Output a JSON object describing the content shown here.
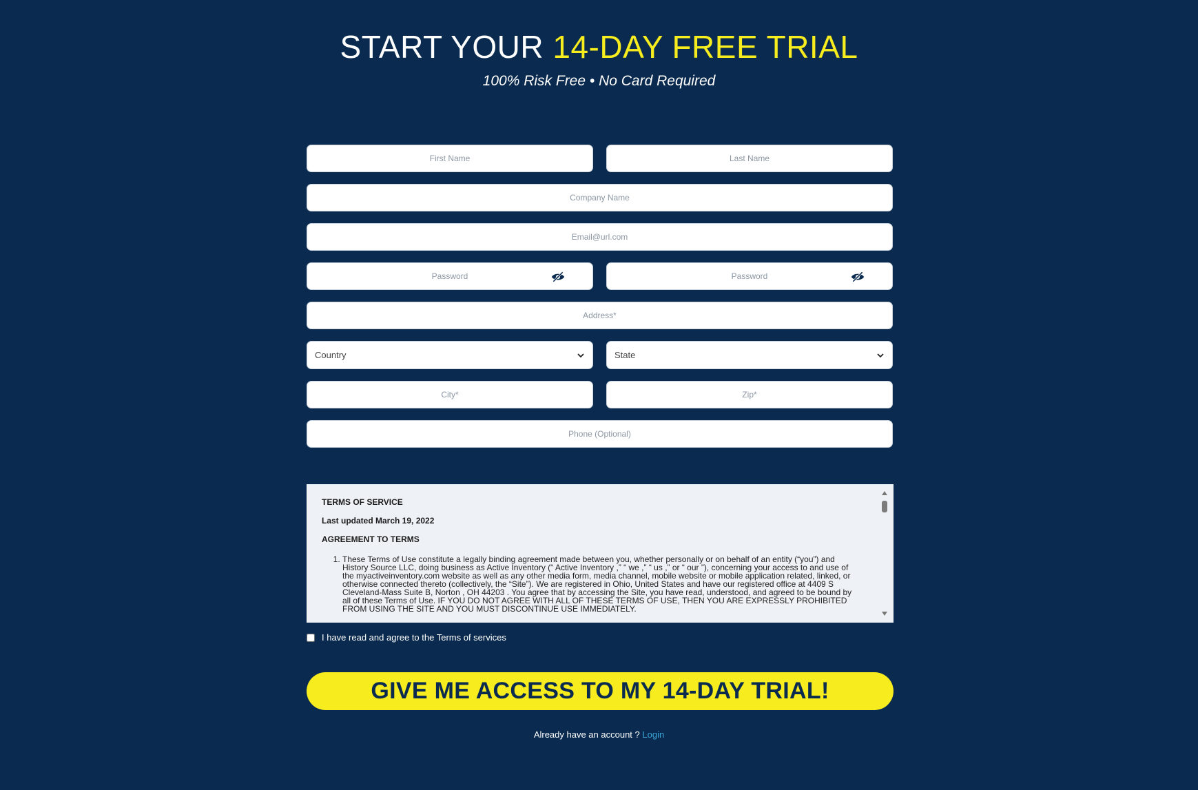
{
  "header": {
    "title_prefix": "START YOUR ",
    "title_accent": "14-DAY FREE TRIAL",
    "subtitle": "100% Risk Free • No Card Required"
  },
  "colors": {
    "background": "#0a2b4f",
    "accent": "#f7ec1e",
    "link": "#3aa6d8"
  },
  "form": {
    "first_name": {
      "placeholder": "First Name",
      "value": ""
    },
    "last_name": {
      "placeholder": "Last Name",
      "value": ""
    },
    "company": {
      "placeholder": "Company Name",
      "value": ""
    },
    "email": {
      "placeholder": "Email@url.com",
      "value": ""
    },
    "password": {
      "placeholder": "Password",
      "value": ""
    },
    "password_confirm": {
      "placeholder": "Password",
      "value": ""
    },
    "address": {
      "placeholder": "Address*",
      "value": ""
    },
    "country": {
      "label": "Country"
    },
    "state": {
      "label": "State"
    },
    "city": {
      "placeholder": "City*",
      "value": ""
    },
    "zip": {
      "placeholder": "Zip*",
      "value": ""
    },
    "phone": {
      "placeholder": "Phone (Optional)",
      "value": ""
    }
  },
  "icons": {
    "password_toggle": "eye-slash-icon",
    "select_arrow": "chevron-down-icon"
  },
  "terms": {
    "heading": "TERMS OF SERVICE",
    "updated": "Last updated March 19, 2022",
    "agreement_heading": "AGREEMENT TO TERMS",
    "paragraph_1": "These Terms of Use constitute a legally binding agreement made between you, whether personally or on behalf of an entity (“you”) and History Source LLC, doing business as Active Inventory (“ Active Inventory ,” “ we ,” “ us ,” or “ our ”), concerning your access to and use of the myactiveinventory.com website as well as any other media form, media channel, mobile website or mobile application related, linked, or otherwise connected thereto (collectively, the “Site”). We are registered in Ohio, United States and have our registered office at 4409 S Cleveland-Mass Suite B, Norton , OH 44203 . You agree that by accessing the Site, you have read, understood, and agreed to be bound by all of these Terms of Use. IF YOU DO NOT AGREE WITH ALL OF THESE TERMS OF USE, THEN YOU ARE EXPRESSLY PROHIBITED FROM USING THE SITE AND YOU MUST DISCONTINUE USE IMMEDIATELY."
  },
  "agree": {
    "label": "I have read and agree to the Terms of services",
    "checked": false
  },
  "cta": {
    "label": "GIVE ME ACCESS TO MY 14-DAY TRIAL!"
  },
  "login": {
    "prompt": "Already have an account ? ",
    "link_label": "Login"
  }
}
